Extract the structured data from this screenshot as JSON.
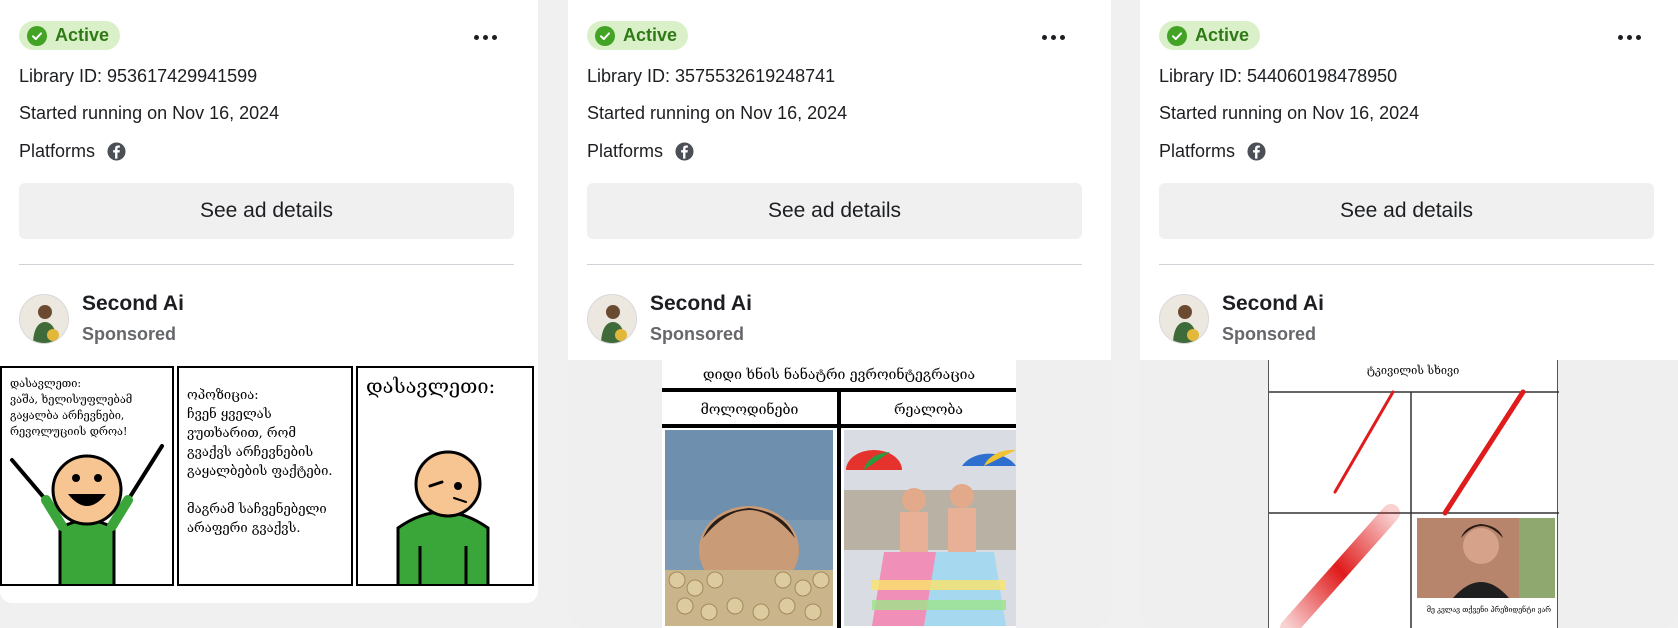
{
  "cards": [
    {
      "status": "Active",
      "library_id": "Library ID: 953617429941599",
      "started": "Started running on Nov 16, 2024",
      "platforms_label": "Platforms",
      "details_button": "See ad details",
      "advertiser": "Second Ai",
      "sponsored": "Sponsored",
      "creative": {
        "panel1": "დასავლეთი:\nვაშა, ხელისუფლებამ\nგაყალბა არჩევნები,\nრევოლუციის დროა!",
        "panel2": "ოპოზიცია:\nჩვენ ყველას\nვუთხარით, რომ\nგვაქვს არჩევნების\nგაყალბების ფაქტები.\n\nმაგრამ საჩვენებელი\nარაფერი გვაქვს.",
        "panel3": "დასავლეთი:"
      }
    },
    {
      "status": "Active",
      "library_id": "Library ID: 3575532619248741",
      "started": "Started running on Nov 16, 2024",
      "platforms_label": "Platforms",
      "details_button": "See ad details",
      "advertiser": "Second Ai",
      "sponsored": "Sponsored",
      "creative": {
        "title": "დიდი ხნის ნანატრი ევროინტეგრაცია",
        "left_header": "მოლოდინები",
        "right_header": "რეალობა"
      }
    },
    {
      "status": "Active",
      "library_id": "Library ID: 544060198478950",
      "started": "Started running on Nov 16, 2024",
      "platforms_label": "Platforms",
      "details_button": "See ad details",
      "advertiser": "Second Ai",
      "sponsored": "Sponsored",
      "creative": {
        "title": "ტკივილის სხივი",
        "caption": "მე კვლავ თქვენი პრეზიდენტი ვარ"
      }
    }
  ],
  "icons": {
    "status": "check-circle-icon",
    "more": "more-horizontal-icon",
    "platform": "facebook-icon"
  },
  "colors": {
    "active_badge_bg": "#d9f0c8",
    "active_check": "#43a325",
    "page_bg": "#f0f0f0",
    "button_bg": "#f0f0f0"
  }
}
